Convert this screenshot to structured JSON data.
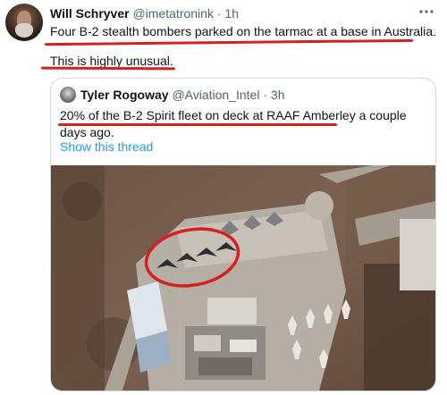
{
  "tweet": {
    "author_name": "Will Schryver",
    "author_handle": "@imetatronink",
    "separator": "·",
    "time": "1h",
    "more_icon": "more-horizontal-icon",
    "text_line1": "Four B-2 stealth bombers parked on the tarmac at a base in Australia.",
    "text_line2": "This is highly unusual."
  },
  "quoted": {
    "author_name": "Tyler Rogoway",
    "author_handle": "@Aviation_Intel",
    "separator": "·",
    "time": "3h",
    "text": "20% of the B-2 Spirit fleet on deck at RAAF Amberley a couple days ago.",
    "show_thread": "Show this thread"
  },
  "colors": {
    "annotation_red": "#d61f1f",
    "link_blue": "#1d9bf0",
    "secondary_text": "#536471"
  }
}
